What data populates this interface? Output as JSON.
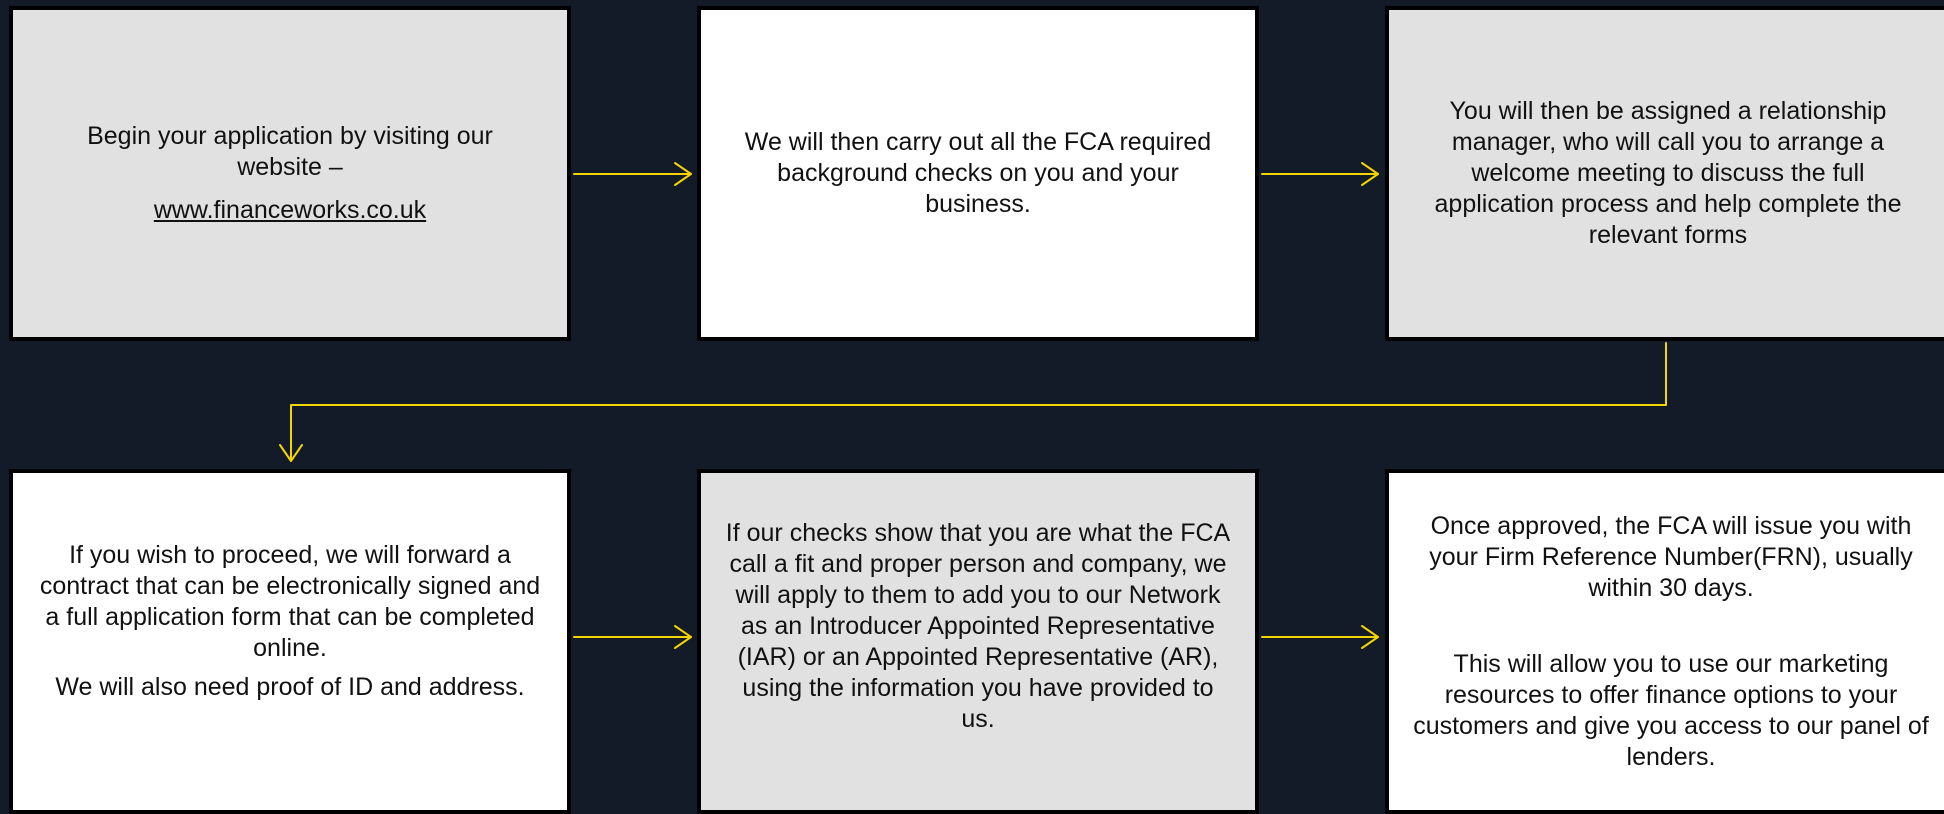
{
  "colors": {
    "background": "#141b28",
    "box_gray": "#e1e1e1",
    "box_white": "#ffffff",
    "box_border": "#000000",
    "arrow": "#f5d400",
    "text": "#111111"
  },
  "steps": [
    {
      "text": "Begin your application by visiting our website –",
      "link": "www.financeworks.co.uk"
    },
    {
      "text": "We will then carry out all the FCA required background checks on you and your business."
    },
    {
      "text": "You will then be assigned a relationship manager, who will call you to arrange a welcome meeting to discuss the full application process and help complete the relevant forms"
    },
    {
      "text": "If you wish to proceed, we will forward a contract that can be electronically signed and a full application form that can be completed online.",
      "text2": "We will also need proof of ID and address."
    },
    {
      "text": "If our checks show that you are what the FCA call a fit and proper person and company, we will apply to them to add you to our Network as an Introducer Appointed Representative (IAR) or an Appointed Representative (AR), using the information you have provided to us."
    },
    {
      "text": "Once approved, the FCA will issue you with your Firm Reference Number(FRN), usually within 30 days.",
      "text2": "This will allow you to use our marketing resources to offer finance options to your customers and give you access to our panel of lenders."
    }
  ]
}
